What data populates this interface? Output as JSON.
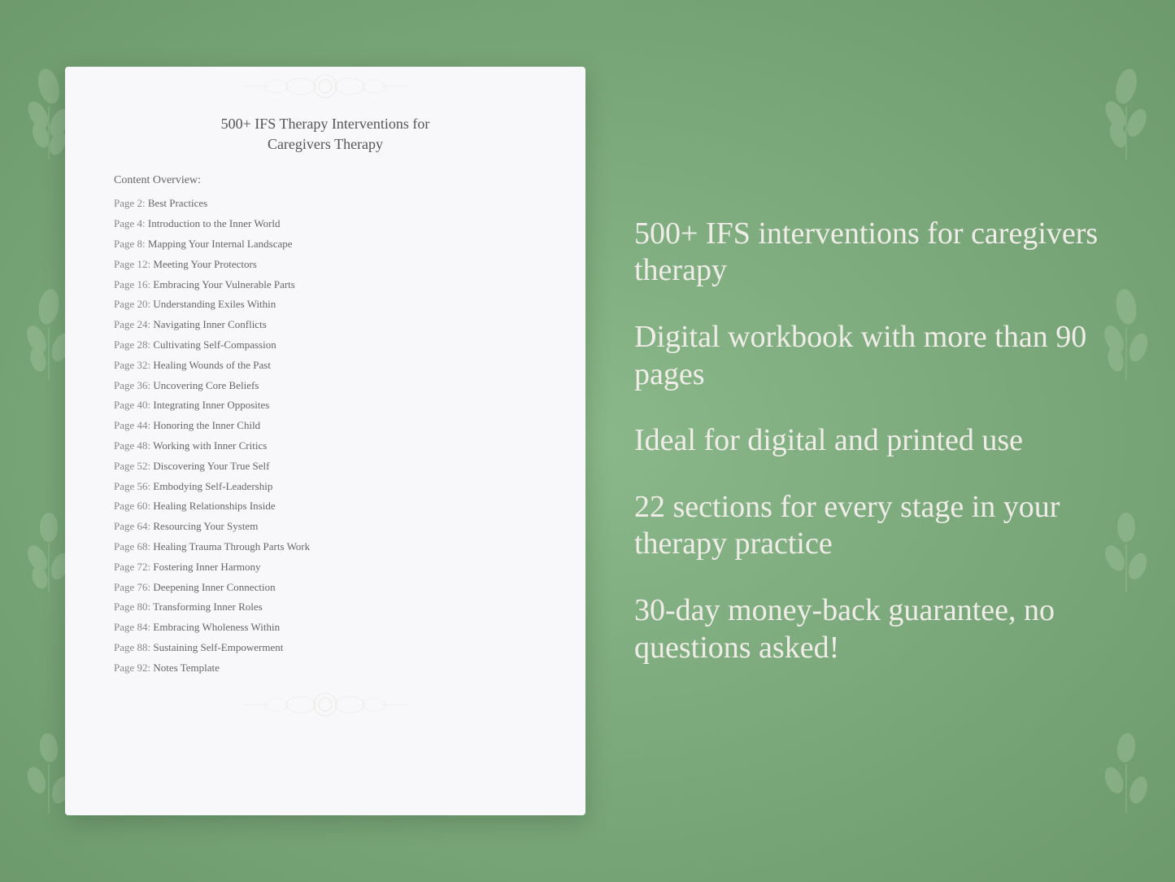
{
  "background": {
    "color": "#7ea87e"
  },
  "document": {
    "title_line1": "500+ IFS Therapy Interventions for",
    "title_line2": "Caregivers Therapy",
    "content_label": "Content Overview:",
    "toc_items": [
      {
        "page": "Page  2:",
        "title": "Best Practices"
      },
      {
        "page": "Page  4:",
        "title": "Introduction to the Inner World"
      },
      {
        "page": "Page  8:",
        "title": "Mapping Your Internal Landscape"
      },
      {
        "page": "Page 12:",
        "title": "Meeting Your Protectors"
      },
      {
        "page": "Page 16:",
        "title": "Embracing Your Vulnerable Parts"
      },
      {
        "page": "Page 20:",
        "title": "Understanding Exiles Within"
      },
      {
        "page": "Page 24:",
        "title": "Navigating Inner Conflicts"
      },
      {
        "page": "Page 28:",
        "title": "Cultivating Self-Compassion"
      },
      {
        "page": "Page 32:",
        "title": "Healing Wounds of the Past"
      },
      {
        "page": "Page 36:",
        "title": "Uncovering Core Beliefs"
      },
      {
        "page": "Page 40:",
        "title": "Integrating Inner Opposites"
      },
      {
        "page": "Page 44:",
        "title": "Honoring the Inner Child"
      },
      {
        "page": "Page 48:",
        "title": "Working with Inner Critics"
      },
      {
        "page": "Page 52:",
        "title": "Discovering Your True Self"
      },
      {
        "page": "Page 56:",
        "title": "Embodying Self-Leadership"
      },
      {
        "page": "Page 60:",
        "title": "Healing Relationships Inside"
      },
      {
        "page": "Page 64:",
        "title": "Resourcing Your System"
      },
      {
        "page": "Page 68:",
        "title": "Healing Trauma Through Parts Work"
      },
      {
        "page": "Page 72:",
        "title": "Fostering Inner Harmony"
      },
      {
        "page": "Page 76:",
        "title": "Deepening Inner Connection"
      },
      {
        "page": "Page 80:",
        "title": "Transforming Inner Roles"
      },
      {
        "page": "Page 84:",
        "title": "Embracing Wholeness Within"
      },
      {
        "page": "Page 88:",
        "title": "Sustaining Self-Empowerment"
      },
      {
        "page": "Page 92:",
        "title": "Notes Template"
      }
    ]
  },
  "right_panel": {
    "features": [
      "500+ IFS interventions for caregivers therapy",
      "Digital workbook with more than 90 pages",
      "Ideal for digital and printed use",
      "22 sections for every stage in your therapy practice",
      "30-day money-back guarantee, no questions asked!"
    ]
  }
}
